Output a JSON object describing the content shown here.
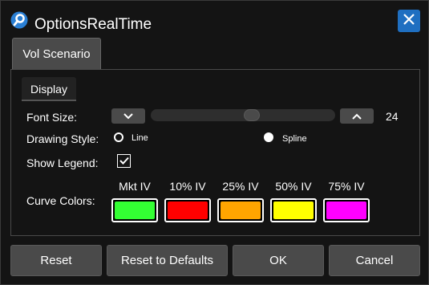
{
  "window": {
    "title": "OptionsRealTime"
  },
  "tabs": [
    {
      "label": "Vol Scenario"
    }
  ],
  "subtabs": [
    {
      "label": "Display"
    }
  ],
  "form": {
    "font_size_label": "Font Size:",
    "font_size_value": "24",
    "font_size_slider_fraction": 0.55,
    "drawing_style_label": "Drawing Style:",
    "drawing_style_options": [
      {
        "label": "Line",
        "selected": false
      },
      {
        "label": "Spline",
        "selected": true
      }
    ],
    "show_legend_label": "Show Legend:",
    "show_legend_checked": true,
    "curve_colors_label": "Curve Colors:",
    "curve_colors": [
      {
        "label": "Mkt IV",
        "color": "#33ff33"
      },
      {
        "label": "10% IV",
        "color": "#ff0000"
      },
      {
        "label": "25% IV",
        "color": "#ffa500"
      },
      {
        "label": "50% IV",
        "color": "#ffff00"
      },
      {
        "label": "75% IV",
        "color": "#ff00ff"
      }
    ]
  },
  "buttons": {
    "reset": "Reset",
    "reset_defaults": "Reset to Defaults",
    "ok": "OK",
    "cancel": "Cancel"
  },
  "icons": {
    "app": "search-icon",
    "close": "close-icon",
    "decrease": "chevron-down-icon",
    "increase": "chevron-up-icon",
    "check": "check-icon"
  },
  "colors": {
    "accent": "#1f6fc1",
    "button": "#4a4a4a",
    "background": "#141414"
  }
}
